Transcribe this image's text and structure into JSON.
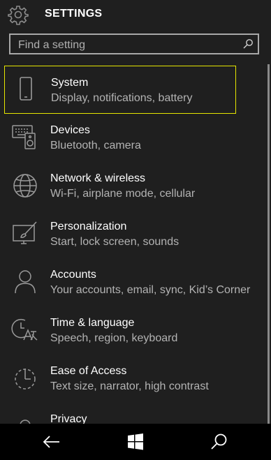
{
  "header": {
    "title": "SETTINGS",
    "icon": "gear-icon"
  },
  "search": {
    "placeholder": "Find a setting",
    "icon": "search-icon"
  },
  "items": [
    {
      "name": "System",
      "desc": "Display, notifications, battery",
      "icon": "phone-icon",
      "selected": true
    },
    {
      "name": "Devices",
      "desc": "Bluetooth, camera",
      "icon": "devices-icon"
    },
    {
      "name": "Network & wireless",
      "desc": "Wi-Fi, airplane mode, cellular",
      "icon": "globe-icon"
    },
    {
      "name": "Personalization",
      "desc": "Start, lock screen, sounds",
      "icon": "personalization-icon"
    },
    {
      "name": "Accounts",
      "desc": "Your accounts, email, sync, Kid’s Corner",
      "icon": "person-icon"
    },
    {
      "name": "Time & language",
      "desc": "Speech, region, keyboard",
      "icon": "time-language-icon"
    },
    {
      "name": "Ease of Access",
      "desc": "Text size, narrator, high contrast",
      "icon": "ease-of-access-icon"
    },
    {
      "name": "Privacy",
      "desc": "",
      "icon": "lock-icon"
    }
  ],
  "navbar": {
    "back_icon": "back-arrow-icon",
    "start_icon": "windows-logo-icon",
    "search_icon": "search-icon"
  },
  "colors": {
    "background": "#1f1f1f",
    "selection_border": "#e6e600",
    "secondary_text": "#b3b3b3",
    "navbar": "#000000"
  }
}
